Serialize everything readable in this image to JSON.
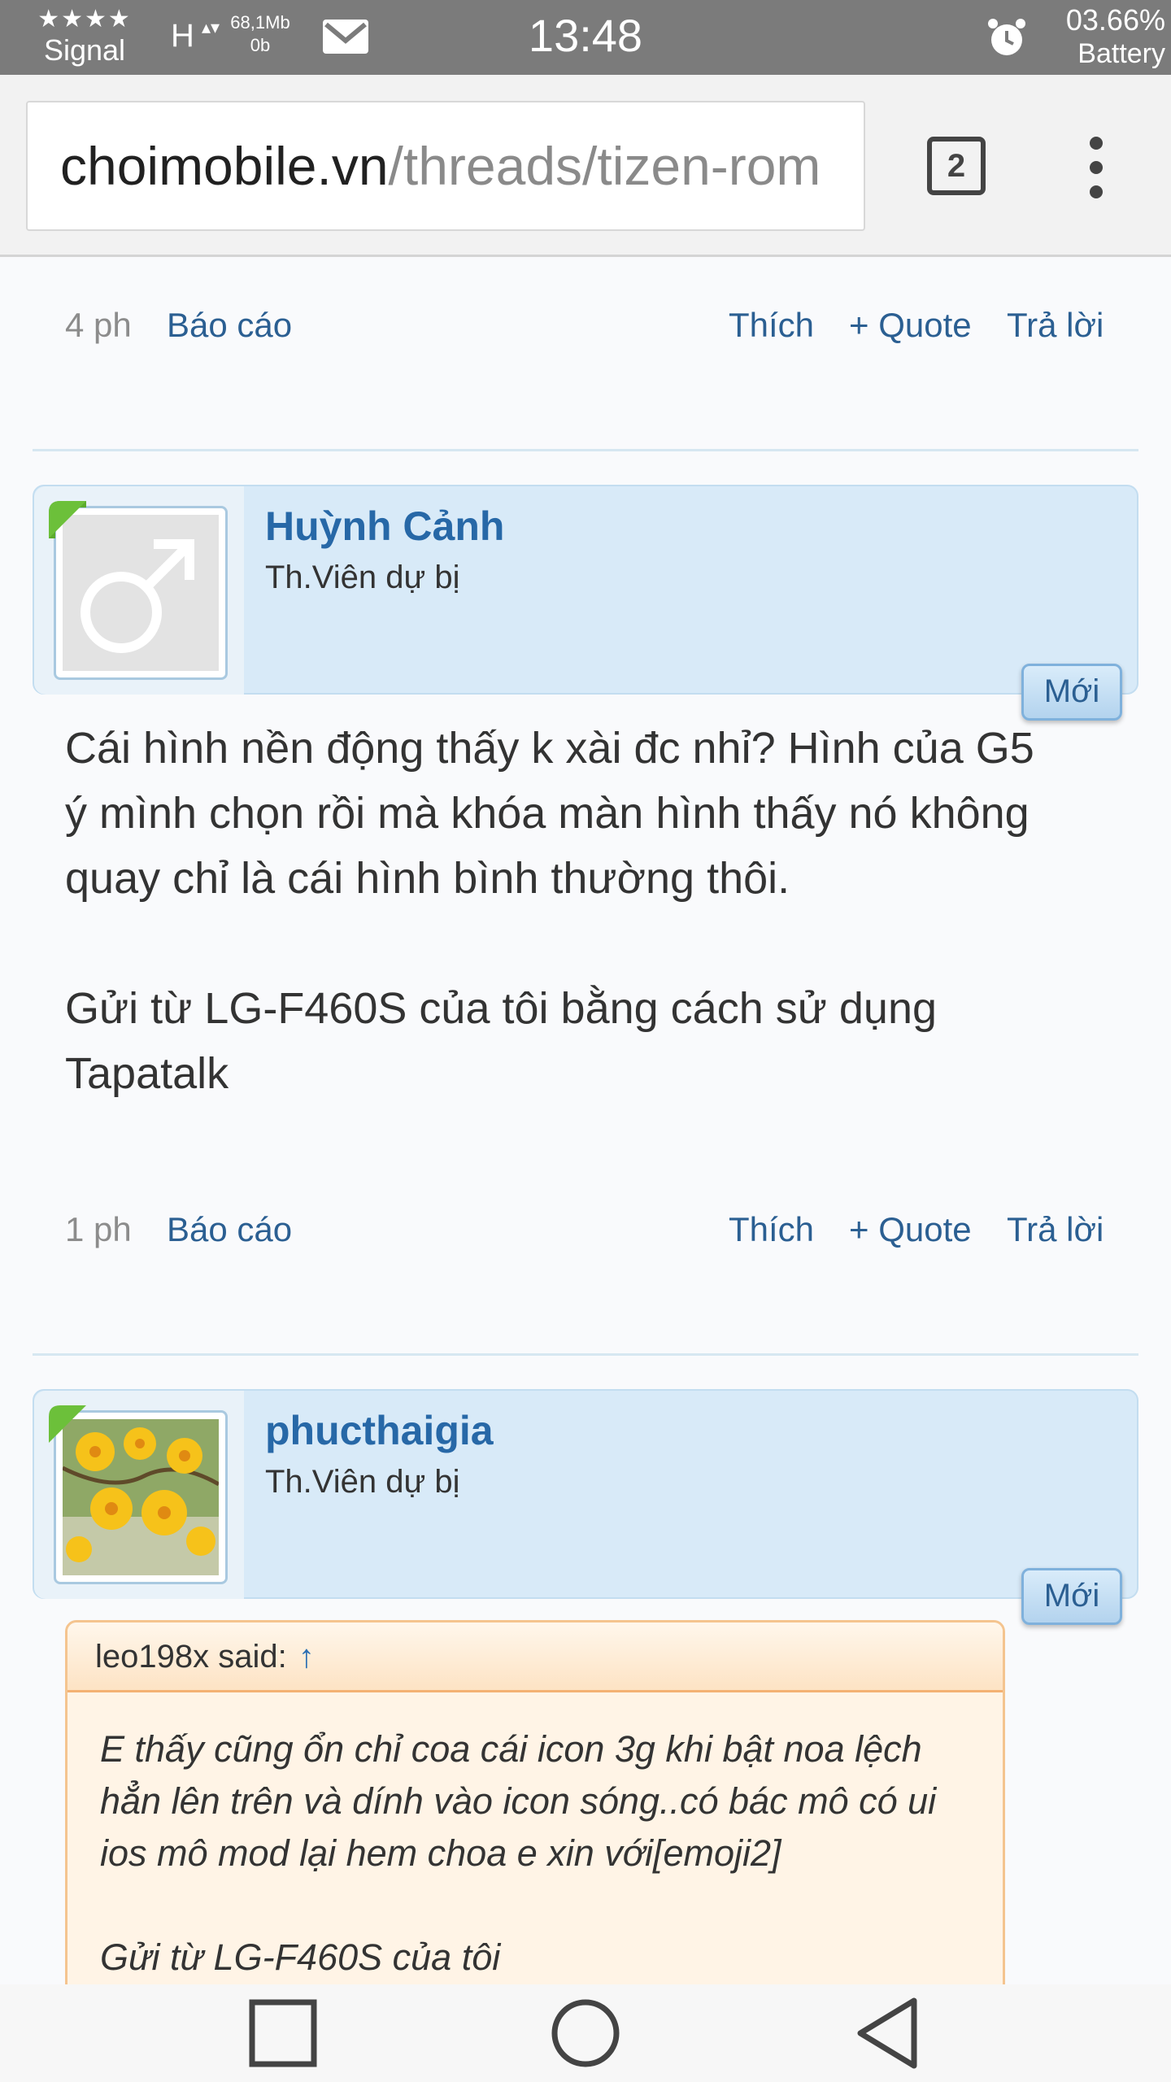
{
  "status_bar": {
    "signal_stars": "★★★★",
    "signal_label": "Signal",
    "network": "H",
    "network_arrows": "▴▾",
    "data_up": "68,1Mb",
    "data_down": "0b",
    "time": "13:48",
    "battery_percent": "03.66%",
    "battery_label": "Battery"
  },
  "browser": {
    "url_host": "choimobile.vn",
    "url_path": "/threads/tizen-rom",
    "tab_count": "2"
  },
  "posts": [
    {
      "time": "4 ph",
      "report": "Báo cáo",
      "like": "Thích",
      "quote": "+ Quote",
      "reply": "Trả lời"
    },
    {
      "username": "Huỳnh Cảnh",
      "user_title": "Th.Viên dự bị",
      "new_badge": "Mới",
      "body": "Cái hình nền động thấy k xài đc nhỉ? Hình của G5 ý mình chọn rồi mà khóa màn hình thấy nó không quay chỉ là cái hình bình thường thôi.\n\nGửi từ LG-F460S của tôi bằng cách sử dụng Tapatalk",
      "time": "1 ph",
      "report": "Báo cáo",
      "like": "Thích",
      "quote": "+ Quote",
      "reply": "Trả lời"
    },
    {
      "username": "phucthaigia",
      "user_title": "Th.Viên dự bị",
      "new_badge": "Mới",
      "quote_author": "leo198x said:",
      "quote_arrow": "↑",
      "quote_text": "E thấy cũng ổn chỉ coa cái icon 3g khi bật noa lệch hẳn lên trên và dính vào icon sóng..có bác mô có ui ios mô mod lại hem choa e xin với[emoji2]\n\nGửi từ LG-F460S của tôi"
    }
  ],
  "colors": {
    "link": "#2b5f92",
    "username": "#2768a7",
    "user_block_bg": "#d8eaf8",
    "quote_bg": "#fff4e6"
  }
}
